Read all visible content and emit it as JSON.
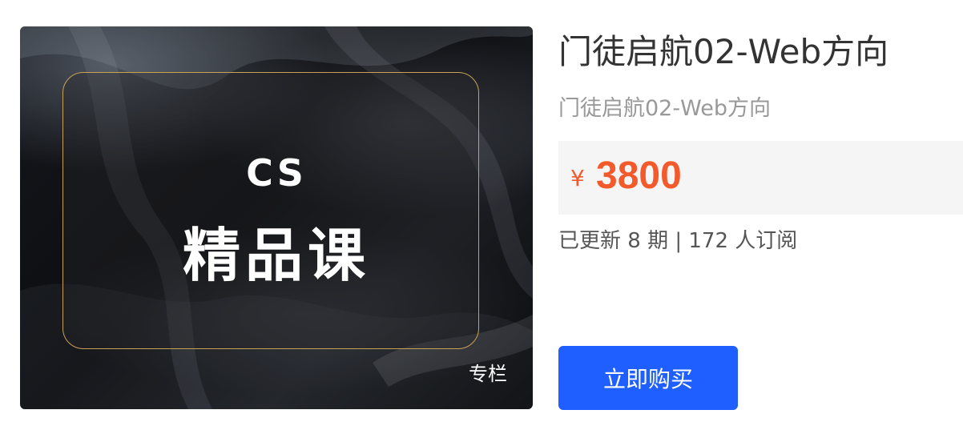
{
  "cover": {
    "headline": "CS",
    "course_label": "精品课",
    "type_tag": "专栏",
    "frame_color": "#c9a258"
  },
  "product": {
    "title": "门徒启航02-Web方向",
    "subtitle": "门徒启航02-Web方向",
    "price": {
      "currency_symbol": "¥",
      "amount": "3800",
      "color": "#f25a2c"
    },
    "stats": "已更新 8 期 | 172 人订阅"
  },
  "actions": {
    "buy_label": "立即购买",
    "buy_color": "#1f5eff"
  }
}
